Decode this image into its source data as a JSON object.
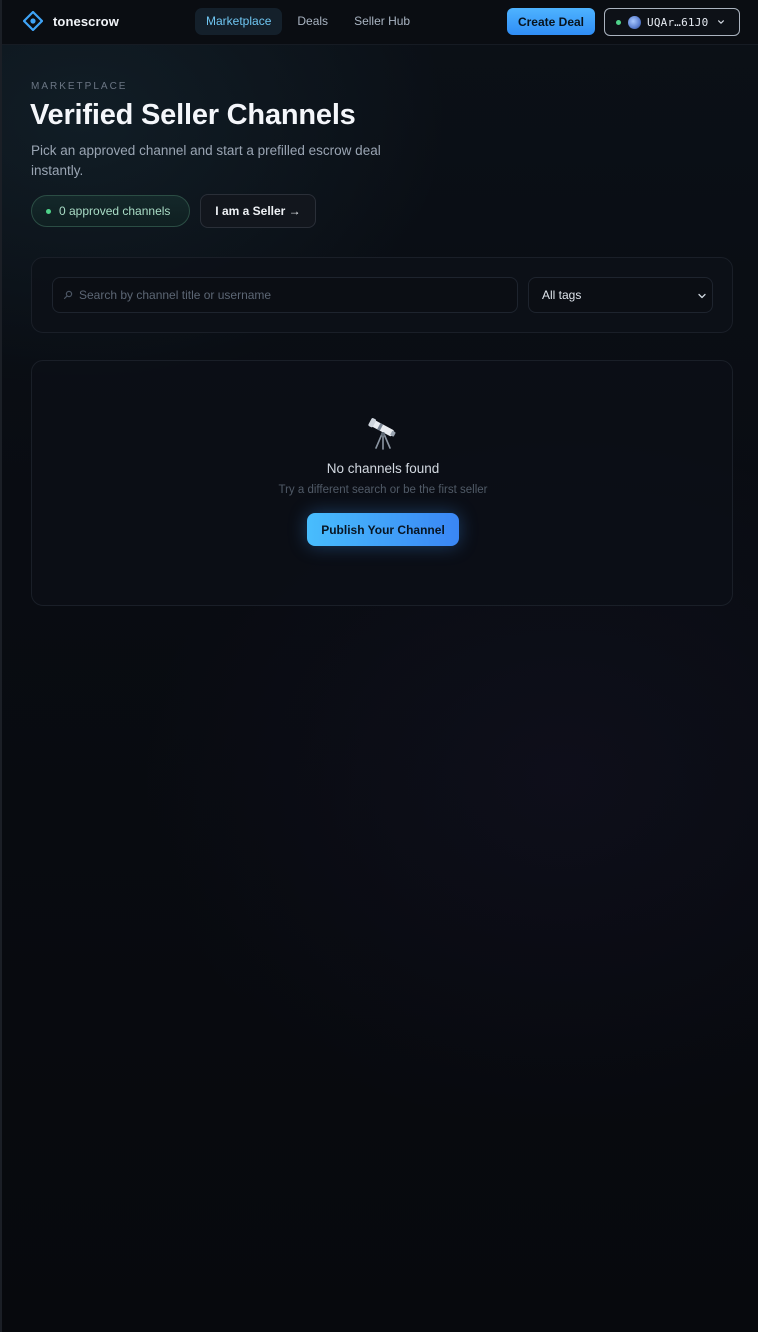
{
  "header": {
    "brand": "tonescrow",
    "nav": [
      {
        "label": "Marketplace",
        "active": true
      },
      {
        "label": "Deals",
        "active": false
      },
      {
        "label": "Seller Hub",
        "active": false
      }
    ],
    "create_label": "Create Deal",
    "wallet": {
      "address": "UQAr…61J0",
      "status": "connected"
    }
  },
  "hero": {
    "eyebrow": "MARKETPLACE",
    "title": "Verified Seller Channels",
    "subtitle": "Pick an approved channel and start a prefilled escrow deal instantly.",
    "approved_pill": "0 approved channels",
    "seller_button": "I am a Seller →"
  },
  "filters": {
    "search_placeholder": "Search by channel title or username",
    "search_value": "",
    "tags_selected": "All tags"
  },
  "empty_state": {
    "icon": "telescope-icon",
    "title": "No channels found",
    "subtitle": "Try a different search or be the first seller",
    "button": "Publish Your Channel"
  },
  "colors": {
    "accent": "#4eb3ff",
    "status_green": "#4fd38a",
    "background": "#07090d"
  }
}
